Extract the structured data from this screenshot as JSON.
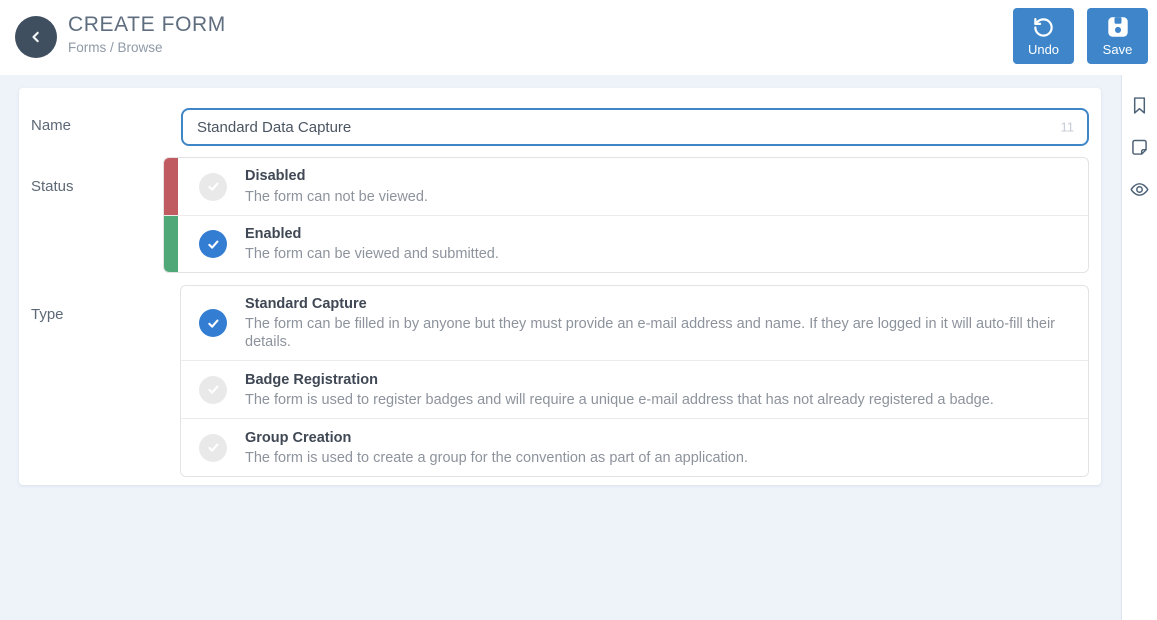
{
  "header": {
    "title": "CREATE FORM",
    "breadcrumb": "Forms / Browse",
    "undo_label": "Undo",
    "save_label": "Save"
  },
  "form": {
    "name_field": {
      "label": "Name",
      "value": "Standard Data Capture",
      "counter": "11"
    },
    "status_field": {
      "label": "Status",
      "options": [
        {
          "title": "Disabled",
          "description": "The form can not be viewed.",
          "selected": false,
          "accent": "#c15b62"
        },
        {
          "title": "Enabled",
          "description": "The form can be viewed and submitted.",
          "selected": true,
          "accent": "#50a878"
        }
      ]
    },
    "type_field": {
      "label": "Type",
      "options": [
        {
          "title": "Standard Capture",
          "description": "The form can be filled in by anyone but they must provide an e-mail address and name. If they are logged in it will auto-fill their details.",
          "selected": true
        },
        {
          "title": "Badge Registration",
          "description": "The form is used to register badges and will require a unique e-mail address that has not already registered a badge.",
          "selected": false
        },
        {
          "title": "Group Creation",
          "description": "The form is used to create a group for the convention as part of an application.",
          "selected": false
        }
      ]
    }
  },
  "sidebar": {
    "icons": [
      "bookmark-icon",
      "note-icon",
      "eye-icon"
    ]
  },
  "colors": {
    "accent_blue": "#3e86c9",
    "selected_blue": "#337dd3",
    "disabled_red": "#c15b62",
    "enabled_green": "#50a878",
    "page_background": "#eef3fa"
  }
}
